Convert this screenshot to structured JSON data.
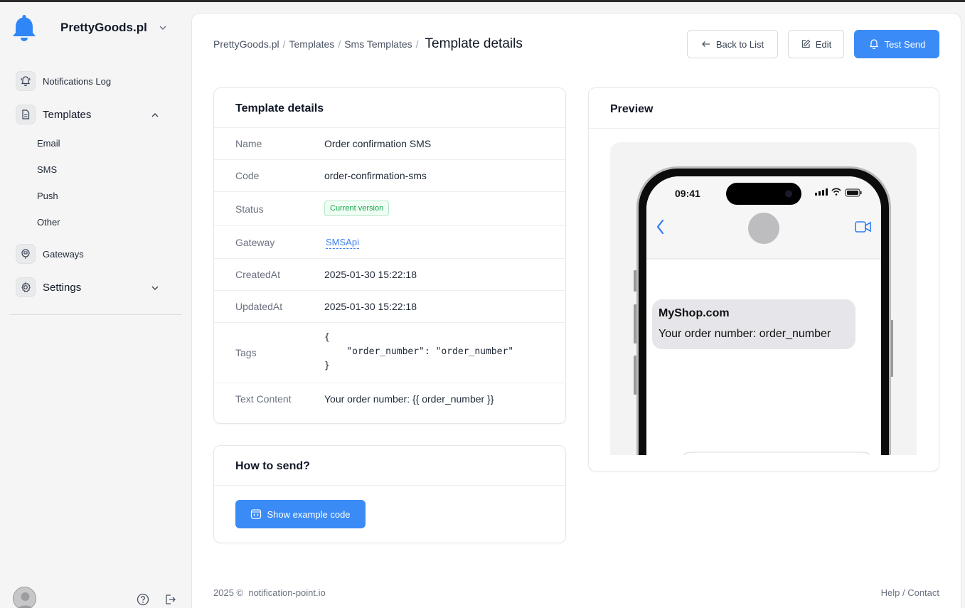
{
  "brand": {
    "name": "PrettyGoods.pl"
  },
  "sidebar": {
    "items": [
      {
        "label": "Notifications Log"
      },
      {
        "label": "Templates"
      },
      {
        "label": "Gateways"
      },
      {
        "label": "Settings"
      }
    ],
    "subitems": [
      {
        "label": "Email"
      },
      {
        "label": "SMS"
      },
      {
        "label": "Push"
      },
      {
        "label": "Other"
      }
    ]
  },
  "breadcrumb": {
    "items": [
      "PrettyGoods.pl",
      "Templates",
      "Sms Templates"
    ],
    "current": "Template details"
  },
  "toolbar": {
    "back_label": "Back to List",
    "edit_label": "Edit",
    "test_send_label": "Test Send"
  },
  "details": {
    "title": "Template details",
    "rows": [
      {
        "label": "Name",
        "value": "Order confirmation SMS"
      },
      {
        "label": "Code",
        "value": "order-confirmation-sms"
      },
      {
        "label": "Status",
        "value": "Current version"
      },
      {
        "label": "Gateway",
        "value": "SMSApi"
      },
      {
        "label": "CreatedAt",
        "value": "2025-01-30 15:22:18"
      },
      {
        "label": "UpdatedAt",
        "value": "2025-01-30 15:22:18"
      },
      {
        "label": "Tags",
        "value": "{\n    \"order_number\": \"order_number\"\n}"
      },
      {
        "label": "Text Content",
        "value": "Your order number: {{ order_number }}"
      }
    ]
  },
  "how_to_send": {
    "title": "How to send?",
    "button_label": "Show example code"
  },
  "preview": {
    "title": "Preview",
    "phone_time": "09:41",
    "sender": "MyShop.com",
    "message": "Your order number: order_number"
  },
  "footer": {
    "copyright": "2025 ©  notification-point.io",
    "help": "Help / Contact"
  },
  "colors": {
    "accent": "#3b8bf7",
    "status_green": "#16a34a"
  }
}
